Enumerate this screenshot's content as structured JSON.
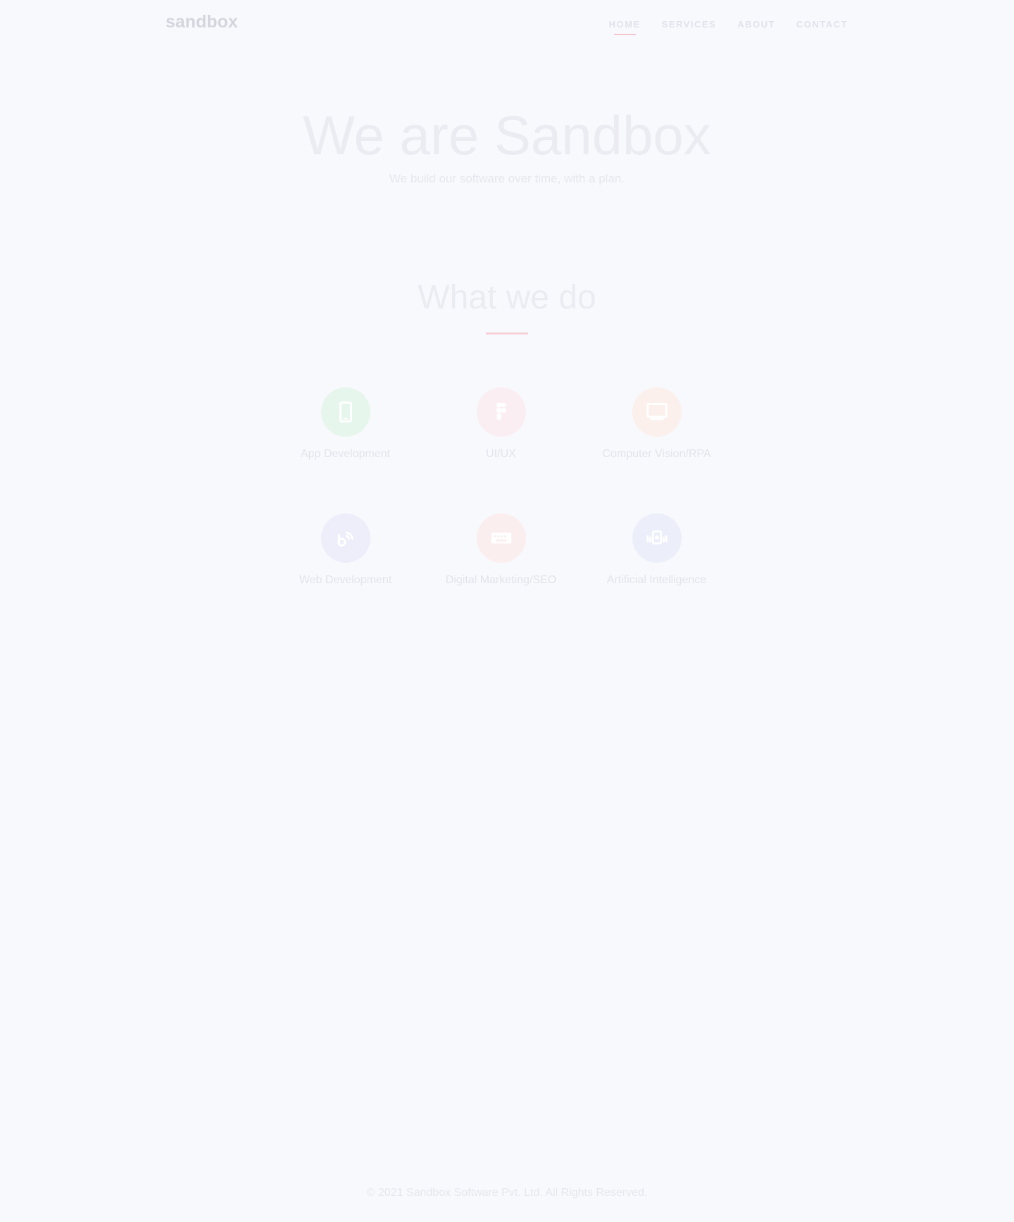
{
  "header": {
    "logo": "sandbox",
    "nav": [
      {
        "label": "HOME",
        "active": true
      },
      {
        "label": "SERVICES",
        "active": false
      },
      {
        "label": "ABOUT",
        "active": false
      },
      {
        "label": "CONTACT",
        "active": false
      }
    ]
  },
  "hero": {
    "title": "We are Sandbox",
    "subtitle": "We build our software over time, with a plan."
  },
  "services_section": {
    "title": "What we do",
    "items": [
      {
        "label": "App Development",
        "icon": "mobile-icon",
        "color": "#e6f6ec"
      },
      {
        "label": "UI/UX",
        "icon": "figma-icon",
        "color": "#fbeef2"
      },
      {
        "label": "Computer Vision/RPA",
        "icon": "monitor-icon",
        "color": "#fbf0ec"
      },
      {
        "label": "Web Development",
        "icon": "web-icon",
        "color": "#eeeefb"
      },
      {
        "label": "Digital Marketing/SEO",
        "icon": "keyboard-icon",
        "color": "#fbeeee"
      },
      {
        "label": "Artificial Intelligence",
        "icon": "ai-icon",
        "color": "#eceff9"
      }
    ]
  },
  "footer": {
    "text": "© 2021 Sandbox Software Pvt. Ltd. All Rights Reserved."
  }
}
